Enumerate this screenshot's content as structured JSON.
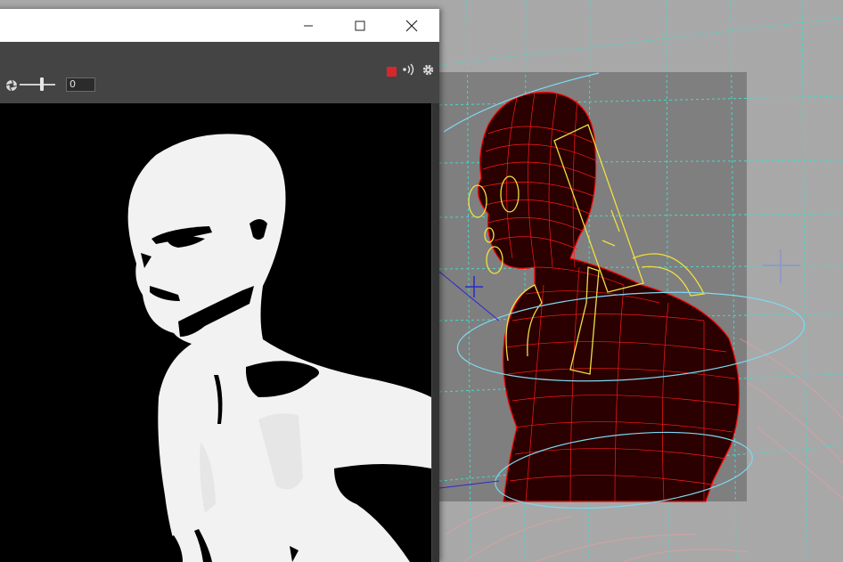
{
  "render_window": {
    "titlebar": {
      "minimize_icon": "minimize-icon",
      "maximize_icon": "maximize-icon",
      "close_icon": "close-icon"
    },
    "toolbar": {
      "exposure_icon": "aperture-icon",
      "exposure_value": "0",
      "record_color": "#d9262c",
      "stream_icon": "broadcast-icon",
      "settings_icon": "gear-icon"
    },
    "canvas": {
      "background": "#000000",
      "subject": "figure"
    }
  },
  "viewport": {
    "background": "#a8a8a8",
    "mesh_color": "#ff0000",
    "rig_control_color": "#f0e040",
    "curve_color": "#7fd8f0",
    "grid_color": "#48d8c8"
  }
}
